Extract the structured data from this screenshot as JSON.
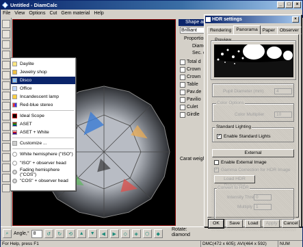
{
  "window": {
    "title": "Untitled - DiamCalc"
  },
  "menu": [
    "File",
    "View",
    "Options",
    "Cut",
    "Gem material",
    "Help"
  ],
  "shape_panel": {
    "title": "Shape an",
    "shape_value": "Brilliant",
    "proportions_label": "Proportions",
    "diameter_label": "Diamet",
    "sec_label": "Sec. d",
    "rows": [
      "Total d",
      "Crown",
      "Crown",
      "Table",
      "Pav.de",
      "Pavilio",
      "Culet",
      "Girdle"
    ],
    "carat_label": "Carat weight"
  },
  "context_menu": {
    "items": [
      {
        "label": "Daylite",
        "selected": false
      },
      {
        "label": "Jewelry shop",
        "selected": false
      },
      {
        "label": "Disco",
        "selected": true
      },
      {
        "label": "Office",
        "selected": false
      },
      {
        "label": "Incandescent lamp",
        "selected": false
      },
      {
        "label": "Red-blue stereo",
        "selected": false
      },
      {
        "label": "Ideal Scope",
        "selected": false
      },
      {
        "label": "ASET",
        "selected": false
      },
      {
        "label": "ASET + White",
        "selected": false
      },
      {
        "label": "Customize ...",
        "selected": false
      },
      {
        "label": "White hemisphere (\"ISO\")",
        "selected": false
      },
      {
        "label": "\"ISO\" + observer head",
        "selected": false
      },
      {
        "label": "Fading hemisphere (\"COS\")",
        "selected": false
      },
      {
        "label": "\"COS\" + observer head",
        "selected": false
      }
    ]
  },
  "hdr_dialog": {
    "title": "HDR settings",
    "close_label": "×",
    "tabs": [
      {
        "label": "Rendering",
        "active": false
      },
      {
        "label": "Panorama",
        "active": true
      },
      {
        "label": "Paper",
        "active": false
      },
      {
        "label": "Observer",
        "active": false
      }
    ],
    "preview_label": "Preview",
    "pupil_label": "Pupil Diameter (mm)",
    "pupil_value": "4",
    "color_options_label": "Color Options",
    "color_multiplier_label": "Color Multiplier",
    "color_multiplier_value": "10",
    "standard_lighting_label": "Standard Lighting",
    "enable_standard_lights_label": "Enable Standard Lights",
    "enable_standard_lights_checked": true,
    "external_label": "External",
    "enable_external_label": "Enable External Image",
    "enable_external_checked": false,
    "gamma_label": "Gamma Correction for HDR Image",
    "gamma_checked": true,
    "load_hdr_label": "Load HDR Panorama",
    "convert_label": "Convert to HDR",
    "intensity_label": "Intensity Threshold",
    "intensity_value": "0",
    "multiply_label": "Multiply Coeff.",
    "multiply_value": "1",
    "buttons": {
      "ok": "OK",
      "save": "Save",
      "load": "Load",
      "apply": "Apply",
      "cancel": "Cancel"
    }
  },
  "bottom_toolbar": {
    "angle_label": "Angle,°",
    "angle_value": "8",
    "rotate_label": "Rotate:",
    "rotate_value": "diamond"
  },
  "status": {
    "help": "For Help, press F1",
    "dmc": "DMC(472 x 605); AVI(464 x 592)",
    "num": "NUM"
  },
  "colors": {
    "title_blue": "#0a246a",
    "selection": "#0a246a",
    "viewport_border": "#800000"
  }
}
